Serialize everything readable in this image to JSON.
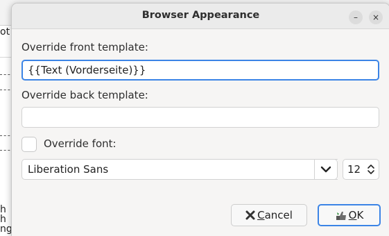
{
  "background": {
    "fragments": [
      "ot",
      "- -",
      "- -",
      "- -",
      "- -",
      "h",
      "h",
      "ng"
    ]
  },
  "dialog": {
    "title": "Browser Appearance",
    "minimize_glyph": "–",
    "close_glyph": "×",
    "front_label": "Override front template:",
    "front_value": "{{Text (Vorderseite)}}",
    "back_label": "Override back template:",
    "back_value": "",
    "font_checkbox_label": "Override font:",
    "font_checked": false,
    "font_name": "Liberation Sans",
    "font_size": "12",
    "cancel_mnemonic": "C",
    "cancel_rest": "ancel",
    "ok_mnemonic": "O",
    "ok_rest": "K"
  },
  "icons": {
    "cancel": "cancel-x-icon",
    "ok": "ok-thumb-icon",
    "dropdown": "chevron-down-icon",
    "spinner": "spin-up-down-icon"
  },
  "colors": {
    "accent": "#3b84e6",
    "dialog_bg": "#f6f5f4",
    "titlebar_bg": "#ebebeb"
  }
}
